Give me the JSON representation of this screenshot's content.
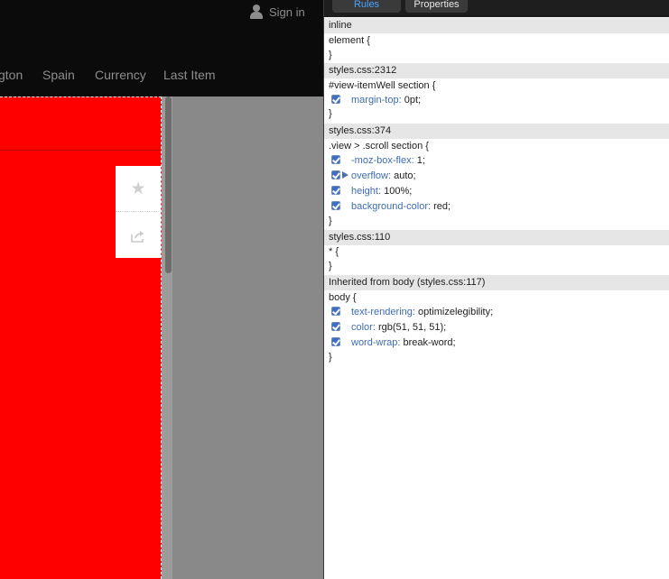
{
  "header": {
    "signin_label": "Sign in",
    "nav": [
      "gton",
      "Spain",
      "Currency",
      "Last Item"
    ]
  },
  "actions": {
    "star_glyph": "★"
  },
  "colors": {
    "panel": "#ff0000",
    "topbar": "#0b0b0b",
    "accent": "#4aa3ff",
    "property": "#3f6bb5"
  },
  "inspector": {
    "tabs": [
      "Rules",
      "Properties"
    ],
    "sections": [
      {
        "header": "inline",
        "selector": "element {",
        "close": "}",
        "props": []
      },
      {
        "header": "styles.css:2312",
        "selector": "#view-itemWell section {",
        "close": "}",
        "props": [
          {
            "name": "margin-top",
            "value": "0pt;"
          }
        ]
      },
      {
        "header": "styles.css:374",
        "selector": ".view > .scroll section {",
        "close": "}",
        "props": [
          {
            "name": "-moz-box-flex",
            "value": "1;"
          },
          {
            "name": "overflow",
            "value": "auto;"
          },
          {
            "name": "height",
            "value": "100%;"
          },
          {
            "name": "background-color",
            "value": "red;"
          }
        ]
      },
      {
        "header": "styles.css:110",
        "selector": "* {",
        "close": "}",
        "props": []
      },
      {
        "header": "Inherited from body (styles.css:117)",
        "selector": "body {",
        "close": "}",
        "props": [
          {
            "name": "text-rendering",
            "value": "optimizelegibility;"
          },
          {
            "name": "color",
            "value": "rgb(51, 51, 51);"
          },
          {
            "name": "word-wrap",
            "value": "break-word;"
          }
        ]
      }
    ]
  }
}
